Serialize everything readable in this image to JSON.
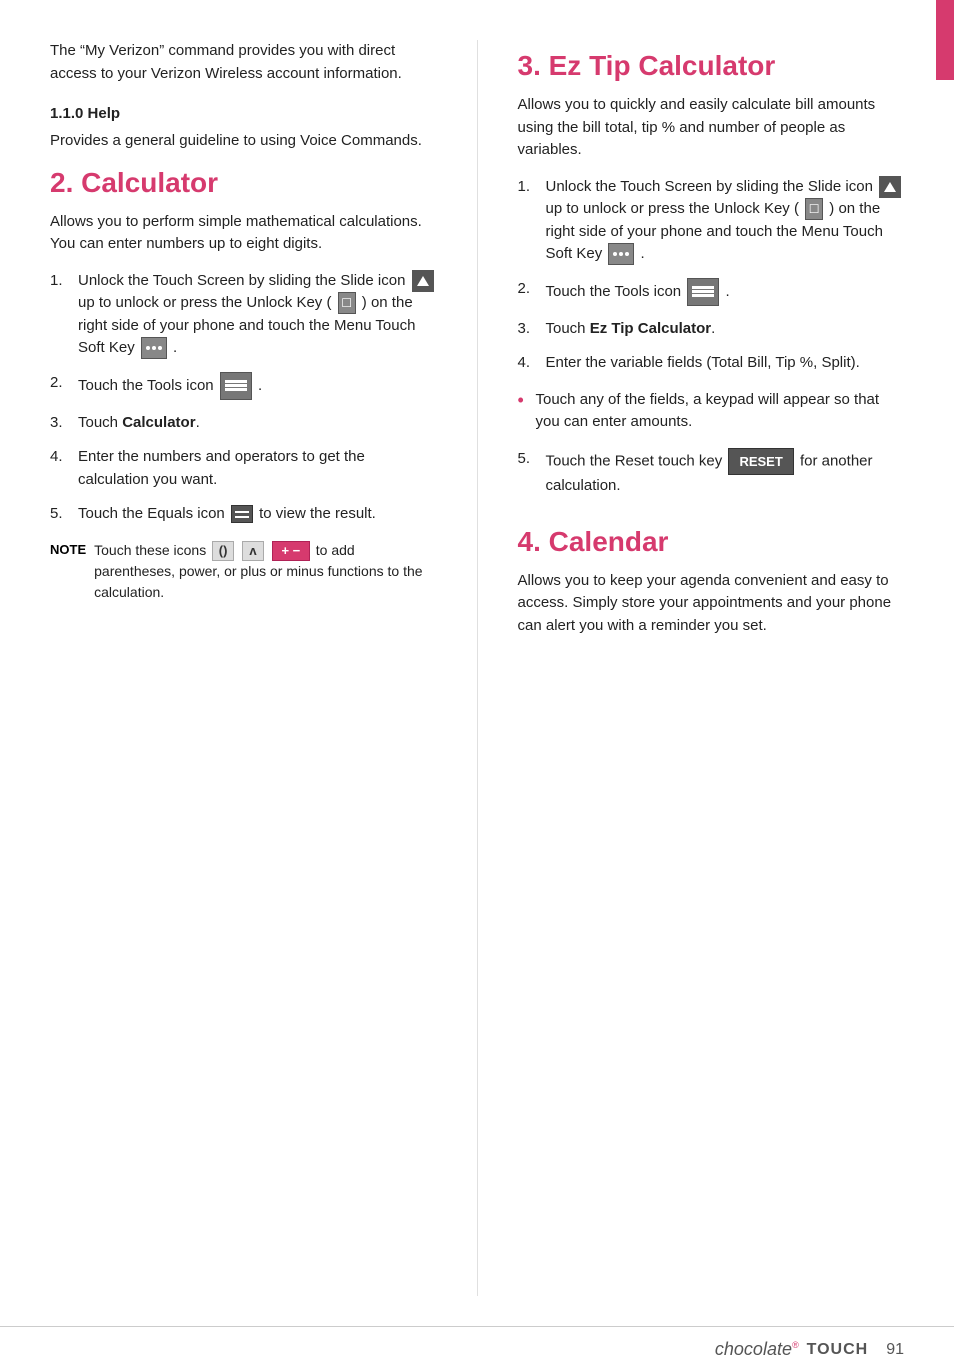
{
  "page": {
    "pink_tab_visible": true
  },
  "left_col": {
    "intro_para": "The “My Verizon” command provides you with direct access to your Verizon Wireless account information.",
    "subheading": "1.1.0 Help",
    "help_para": "Provides a general guideline to using Voice Commands.",
    "section2_heading": "2.  Calculator",
    "section2_intro": "Allows you to perform simple mathematical calculations. You can enter numbers up to eight digits.",
    "steps": [
      {
        "num": "1.",
        "text_parts": [
          "Unlock the Touch Screen by sliding the Slide icon ",
          "[slide-icon]",
          " up to unlock or press the Unlock Key ( ",
          "[key-icon]",
          " ) on the right side of your phone and touch the Menu Touch Soft Key ",
          "[menu-icon]",
          " ."
        ]
      },
      {
        "num": "2.",
        "text_parts": [
          "Touch the Tools icon ",
          "[tools-icon]",
          " ."
        ]
      },
      {
        "num": "3.",
        "text_parts": [
          "Touch ",
          "[bold]Calculator[/bold]",
          "."
        ]
      },
      {
        "num": "4.",
        "text_parts": [
          "Enter the numbers and operators to get the calculation you want."
        ]
      },
      {
        "num": "5.",
        "text_parts": [
          "Touch the Equals icon ",
          "[equals-icon]",
          " to view the result."
        ]
      }
    ],
    "note_label": "NOTE",
    "note_text_parts": [
      "Touch these icons ",
      "[paren-icon]()",
      " ",
      "[power-icon]^",
      " ",
      "[plusminus-icon]",
      " to add parentheses, power, or plus or minus functions to the calculation."
    ]
  },
  "right_col": {
    "section3_heading": "3.  Ez Tip Calculator",
    "section3_intro": "Allows you to quickly and easily calculate bill amounts using the bill total, tip % and number of people as variables.",
    "steps": [
      {
        "num": "1.",
        "text_parts": [
          "Unlock the Touch Screen by sliding the Slide icon ",
          "[slide-icon]",
          " up to unlock or press the Unlock Key ( ",
          "[key-icon]",
          " ) on the right side of your phone and touch the Menu Touch Soft Key ",
          "[menu-icon]",
          " ."
        ]
      },
      {
        "num": "2.",
        "text_parts": [
          "Touch the Tools icon ",
          "[tools-icon]",
          " ."
        ]
      },
      {
        "num": "3.",
        "text_parts": [
          "Touch ",
          "[bold]Ez Tip Calculator[/bold]",
          "."
        ]
      },
      {
        "num": "4.",
        "text_parts": [
          "Enter the variable fields (Total Bill, Tip %, Split)."
        ]
      }
    ],
    "bullets": [
      {
        "text": "Touch any of the fields, a keypad will appear so that you can enter amounts."
      }
    ],
    "step5_num": "5.",
    "step5_text_parts": [
      "Touch the Reset touch key ",
      "[reset-btn]",
      " for another calculation."
    ],
    "section4_heading": "4.  Calendar",
    "section4_intro": "Allows you to keep your agenda convenient and easy to access. Simply store your appointments and your phone can alert you with a reminder you set."
  },
  "footer": {
    "brand": "chocolate",
    "product": "TOUCH",
    "page_number": "91"
  }
}
